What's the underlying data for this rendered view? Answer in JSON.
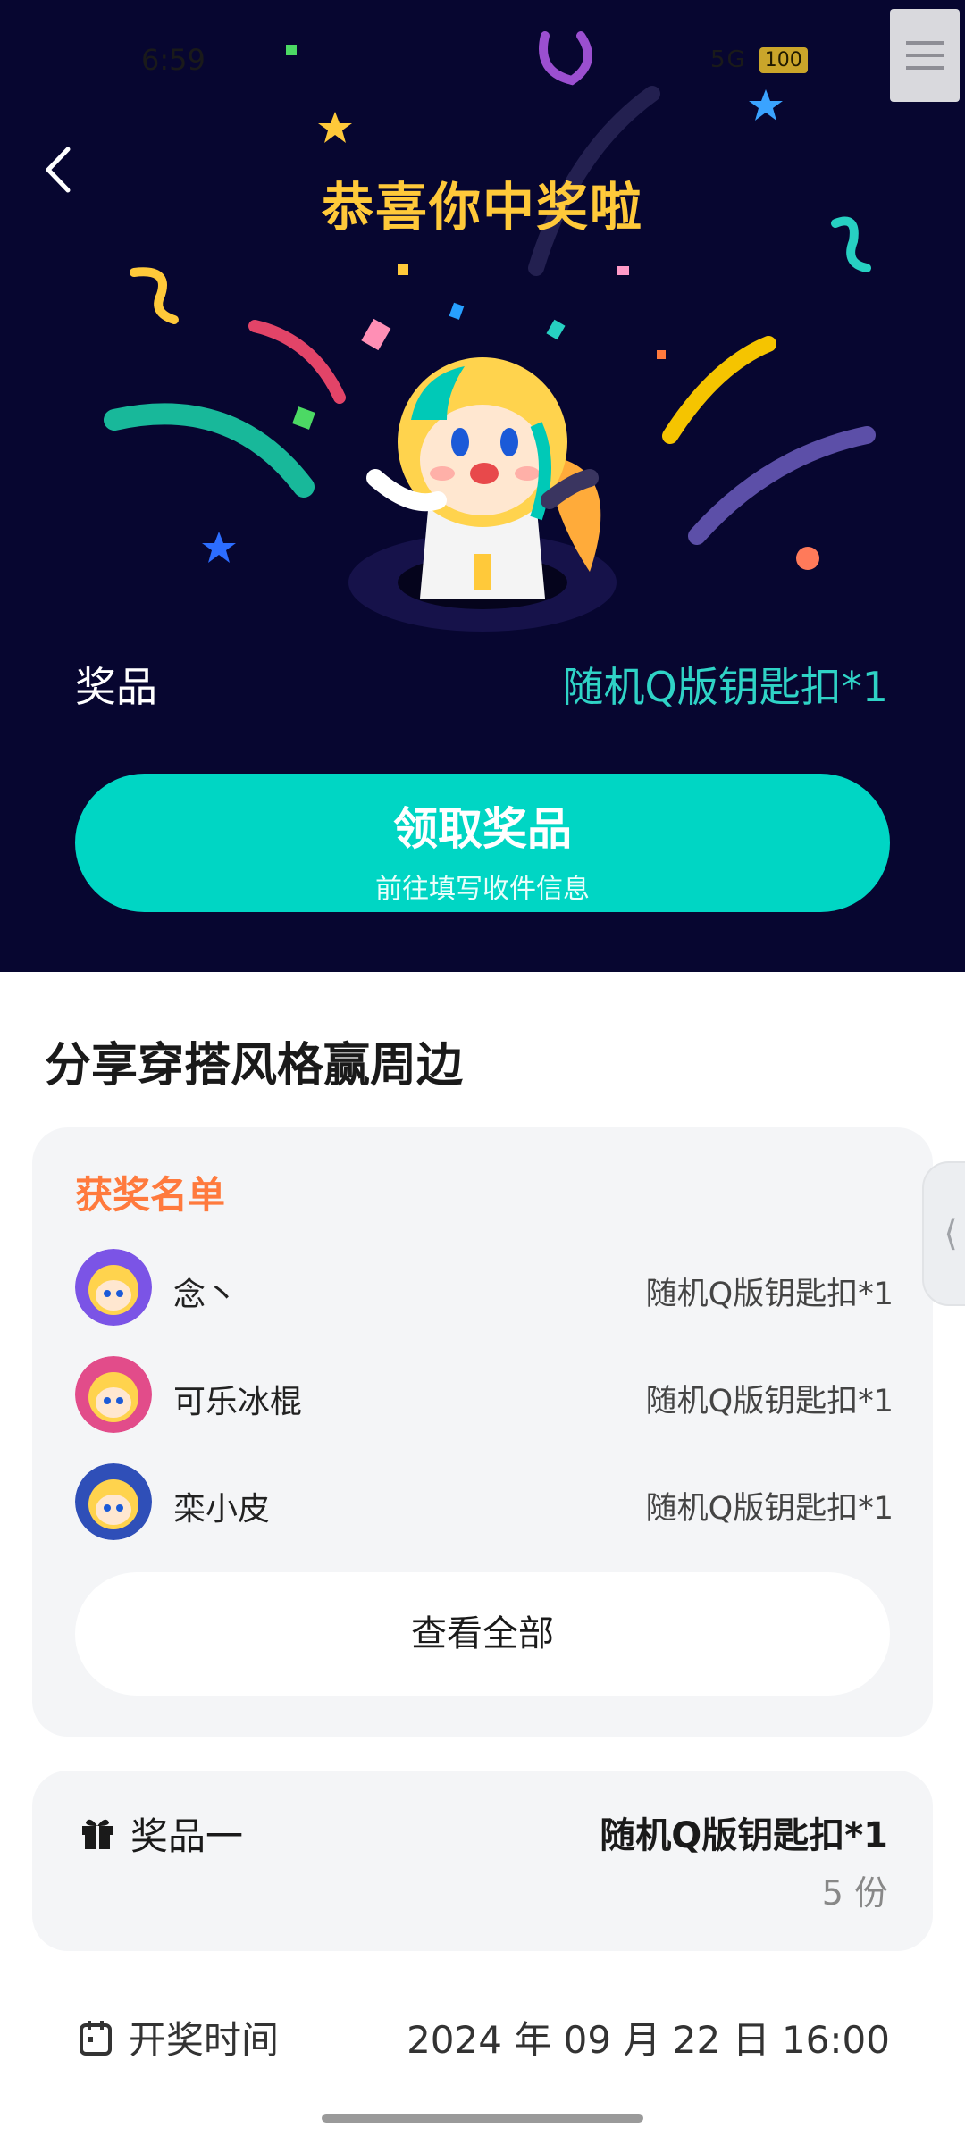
{
  "status_bar": {
    "time": "6:59",
    "signal": "5G",
    "battery": "100"
  },
  "hero": {
    "title": "恭喜你中奖啦",
    "prize_label": "奖品",
    "prize_value": "随机Q版钥匙扣*1",
    "claim_button": {
      "label": "领取奖品",
      "sublabel": "前往填写收件信息"
    }
  },
  "section_title": "分享穿搭风格赢周边",
  "winners": {
    "title": "获奖名单",
    "items": [
      {
        "name": "念丶",
        "prize": "随机Q版钥匙扣*1"
      },
      {
        "name": "可乐冰棍",
        "prize": "随机Q版钥匙扣*1"
      },
      {
        "name": "栾小皮",
        "prize": "随机Q版钥匙扣*1"
      }
    ],
    "view_all": "查看全部"
  },
  "prize_card": {
    "label": "奖品一",
    "value": "随机Q版钥匙扣*1",
    "quantity": "5 份"
  },
  "draw_time": {
    "label": "开奖时间",
    "value": "2024 年 09 月 22 日 16:00"
  },
  "colors": {
    "accent": "#00d6c4",
    "title": "#ffc93a",
    "winners_title": "#ff7a3d",
    "hero_bg": "#070630"
  }
}
